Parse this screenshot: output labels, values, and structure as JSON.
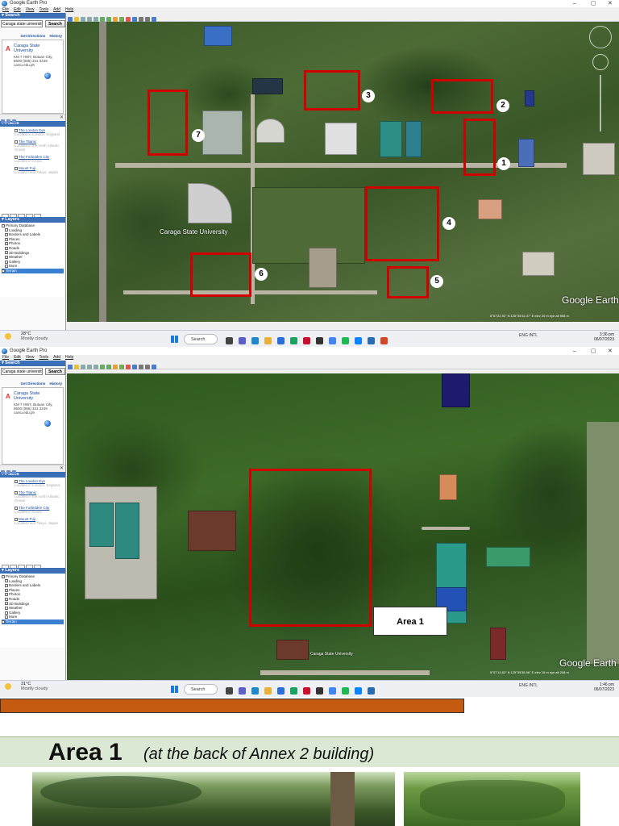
{
  "app_title": "Google Earth Pro",
  "window_controls": [
    "–",
    "▢",
    "✕"
  ],
  "menu": [
    "File",
    "Edit",
    "View",
    "Tools",
    "Add",
    "Help"
  ],
  "sidebar": {
    "search_header": "▾ Search",
    "search_value": "Caraga state university",
    "search_button": "Search",
    "get_directions": "Get Directions",
    "history": "History",
    "result": {
      "marker": "A",
      "name": "Caraga State University",
      "address": "KM 7 HWY, Butuan City, 8600 (085) 341 3249 carsu.edu.ph"
    },
    "places_header": "▾ Places",
    "places": [
      {
        "title": "The London Eye",
        "desc": "Located in London, England"
      },
      {
        "title": "The Titanic",
        "desc": "Located in the north Atlantic Ocean"
      },
      {
        "title": "The Forbidden City",
        "desc": "Located in China"
      },
      {
        "title": "Mount Fuji",
        "desc": "Located near Tokyo, Japan"
      }
    ],
    "layers_header": "▾ Layers",
    "layers": [
      "Primary Database",
      "Loading",
      "Borders and Labels",
      "Places",
      "Photos",
      "Roads",
      "3D Buildings",
      "Weather",
      "Gallery",
      "More",
      "Terrain"
    ]
  },
  "map1": {
    "label": "Caraga State University",
    "numbers": [
      "1",
      "2",
      "3",
      "4",
      "5",
      "6",
      "7"
    ],
    "watermark": "Google Earth",
    "status": "8°57'22.92\" N 125°35'41.07\" E elev 20 m eye alt 958 m"
  },
  "map2": {
    "area_label": "Area 1",
    "watermark": "Google Earth",
    "status": "8°57'13.82\" N 125°35'35.96\" E elev 15 m eye alt 208 m",
    "bottom_label": "Caraga State University"
  },
  "taskbar1": {
    "temp": "28°C",
    "weather": "Mostly cloudy",
    "search": "Search",
    "lang": "ENG INTL",
    "time": "3:36 pm",
    "date": "06/07/2023"
  },
  "taskbar2": {
    "temp": "31°C",
    "weather": "Mostly cloudy",
    "search": "Search",
    "lang": "ENG INTL",
    "time": "1:46 pm",
    "date": "06/07/2023"
  },
  "slide": {
    "heading": "Area 1",
    "subheading": "(at the back of Annex 2 building)"
  },
  "colors": {
    "highlight": "#d00000",
    "orange_bar": "#c55a11",
    "heading_bg": "#dbe9d4"
  }
}
